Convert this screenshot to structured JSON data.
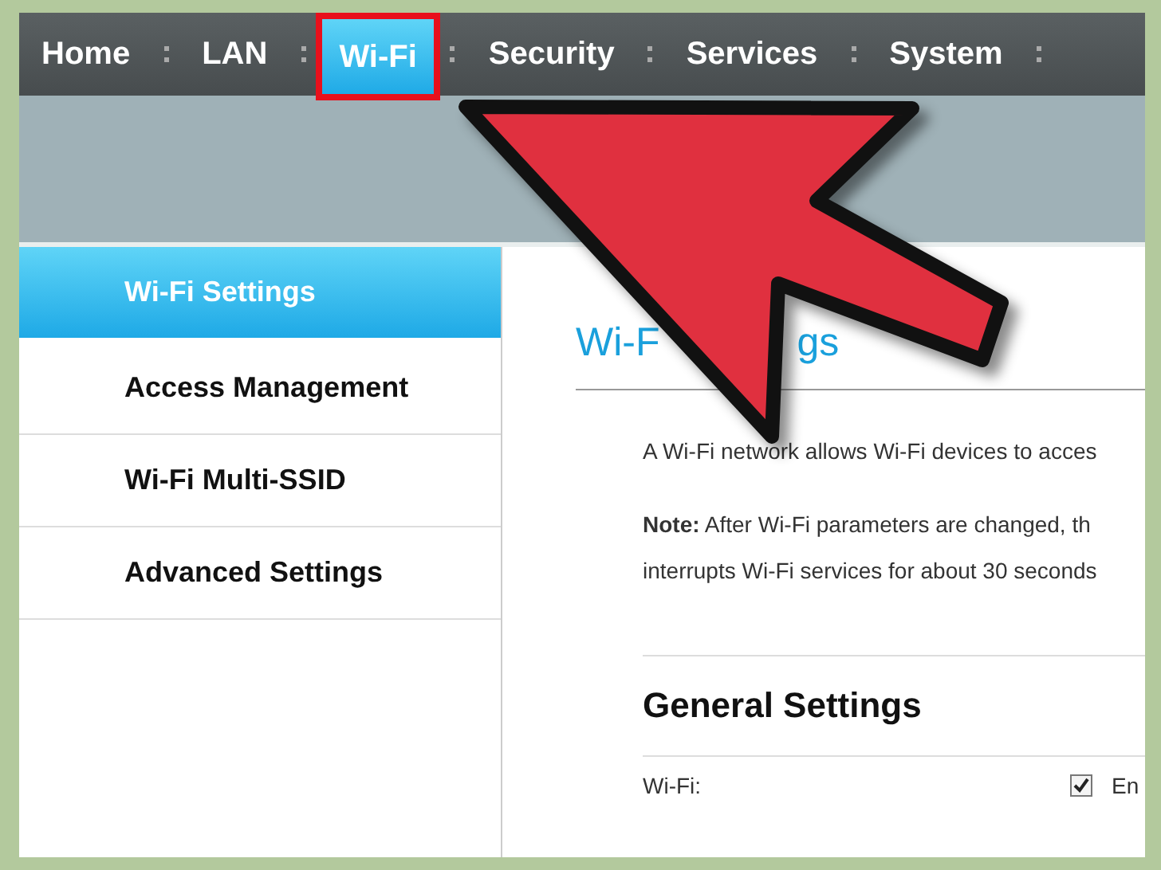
{
  "nav": {
    "tabs": [
      {
        "label": "Home",
        "selected": false
      },
      {
        "label": "LAN",
        "selected": false
      },
      {
        "label": "Wi-Fi",
        "selected": true,
        "highlighted": true
      },
      {
        "label": "Security",
        "selected": false
      },
      {
        "label": "Services",
        "selected": false
      },
      {
        "label": "System",
        "selected": false
      }
    ]
  },
  "sidebar": {
    "items": [
      {
        "label": "Wi-Fi Settings",
        "selected": true
      },
      {
        "label": "Access Management",
        "selected": false
      },
      {
        "label": "Wi-Fi Multi-SSID",
        "selected": false
      },
      {
        "label": "Advanced Settings",
        "selected": false
      }
    ]
  },
  "content": {
    "title_parts": [
      "Wi-F",
      "gs"
    ],
    "intro": "A Wi-Fi network allows Wi-Fi devices to acces",
    "note": [
      "**Note:** After Wi-Fi parameters are changed, th",
      "interrupts Wi-Fi services for about 30 seconds"
    ],
    "section_title": "General Settings",
    "fields": [
      {
        "label": "Wi-Fi:",
        "kind": "checkbox",
        "checked": true,
        "option": "En"
      }
    ]
  },
  "annotation": {
    "kind": "arrow"
  }
}
